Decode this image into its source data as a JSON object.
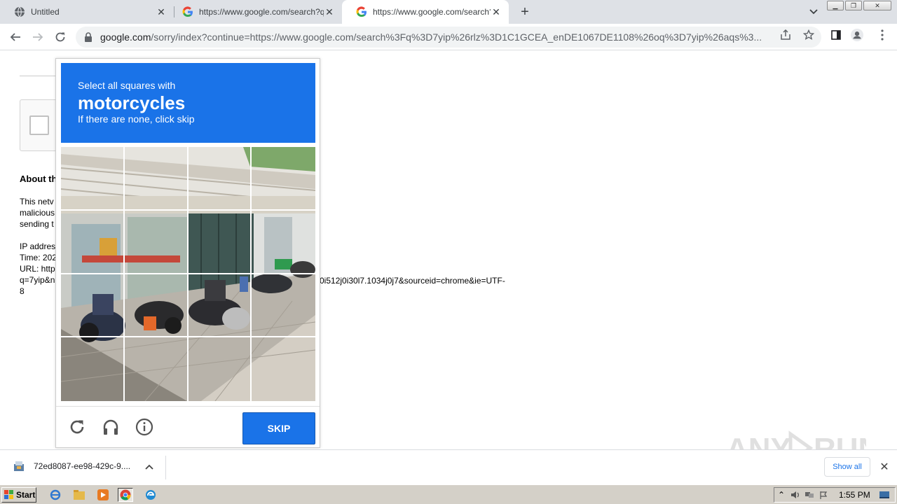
{
  "browser": {
    "tabs": [
      {
        "title": "Untitled",
        "favicon": "globe-icon",
        "active": false
      },
      {
        "title": "https://www.google.com/search?q=",
        "favicon": "google-icon",
        "active": false
      },
      {
        "title": "https://www.google.com/search?q=",
        "favicon": "google-icon",
        "active": true
      }
    ],
    "address_host": "google.com",
    "address_rest": "/sorry/index?continue=https://www.google.com/search%3Fq%3D7yip%26rlz%3D1C1GCEA_enDE1067DE1108%26oq%3D7yip%26aqs%3..."
  },
  "page": {
    "about_title": "About th",
    "para_lines": [
      "This netv",
      "malicious",
      "sending t"
    ],
    "info_lines": [
      "IP addres",
      "Time: 202",
      "URL: http",
      "q=7yip&n",
      "8"
    ],
    "url_tail": "0i512j0i30l7.1034j0j7&sourceid=chrome&ie=UTF-"
  },
  "captcha": {
    "line1": "Select all squares with",
    "target": "motorcycles",
    "line3": "If there are none, click skip",
    "skip_label": "SKIP",
    "footer_icons": [
      "reload-icon",
      "audio-icon",
      "info-icon"
    ]
  },
  "download": {
    "filename": "72ed8087-ee98-429c-9....",
    "show_all": "Show all"
  },
  "taskbar": {
    "start_label": "Start",
    "clock": "1:55 PM"
  },
  "colors": {
    "accent": "#1a73e8",
    "tabstrip": "#dee1e6",
    "taskbar": "#d4d0c8"
  }
}
